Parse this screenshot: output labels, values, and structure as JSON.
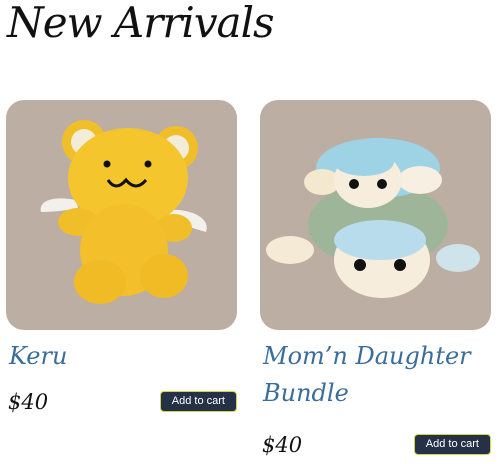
{
  "page": {
    "title": "New Arrivals"
  },
  "products": [
    {
      "name": "Keru",
      "price": "$40",
      "button_label": "Add to cart",
      "image": "yellow crochet bear with white wings"
    },
    {
      "name": "Mom’n Daughter Bundle",
      "price": "$40",
      "button_label": "Add to cart",
      "image": "stacked crochet turtles, blue and cream"
    }
  ],
  "colors": {
    "photo_background": "#bcaea3",
    "product_name": "#3b6d9b",
    "button": "#263148",
    "button_border": "#c9d84a"
  }
}
